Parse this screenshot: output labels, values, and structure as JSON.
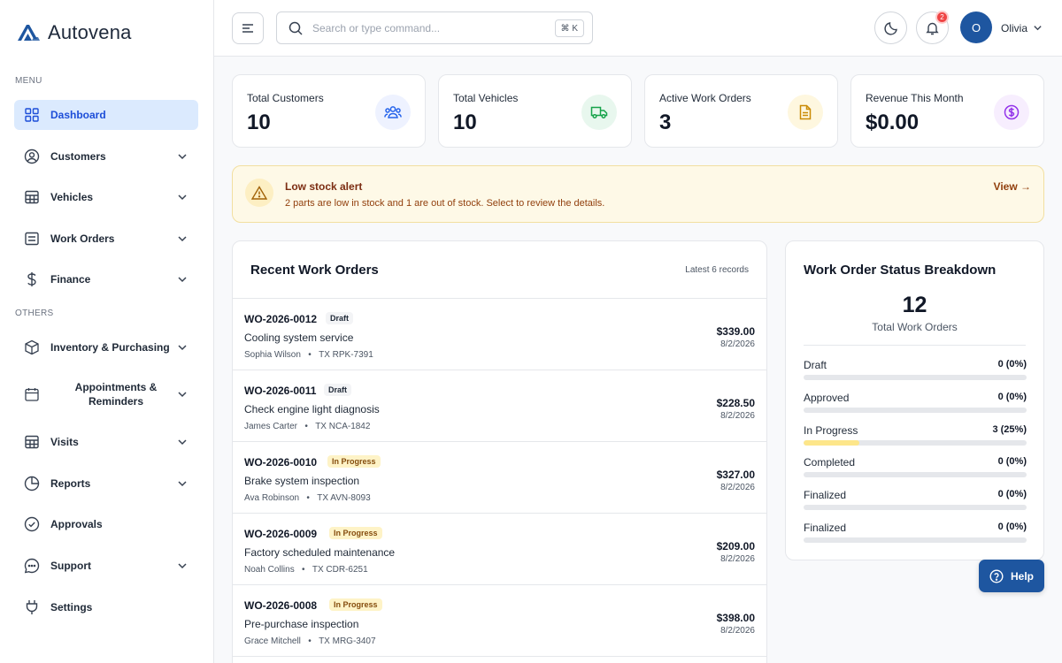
{
  "app": {
    "name": "Autovena"
  },
  "sidebar": {
    "menu_label": "MENU",
    "others_label": "OTHERS",
    "items": [
      {
        "label": "Dashboard",
        "icon": "grid-icon"
      },
      {
        "label": "Customers",
        "icon": "user-circle-icon"
      },
      {
        "label": "Vehicles",
        "icon": "table-icon"
      },
      {
        "label": "Work Orders",
        "icon": "list-icon"
      },
      {
        "label": "Finance",
        "icon": "dollar-icon"
      },
      {
        "label": "Inventory & Purchasing",
        "icon": "box-icon"
      },
      {
        "label": "Appointments & Reminders",
        "icon": "calendar-icon"
      },
      {
        "label": "Visits",
        "icon": "table-icon"
      },
      {
        "label": "Reports",
        "icon": "pie-chart-icon"
      },
      {
        "label": "Approvals",
        "icon": "check-circle-icon"
      },
      {
        "label": "Support",
        "icon": "chat-icon"
      },
      {
        "label": "Settings",
        "icon": "plug-icon"
      }
    ]
  },
  "topbar": {
    "search_placeholder": "Search or type command...",
    "shortcut": "⌘ K",
    "notification_count": "2",
    "user_initial": "O",
    "user_name": "Olivia"
  },
  "stats": [
    {
      "title": "Total Customers",
      "value": "10",
      "icon": "users-icon",
      "color": "#2563eb",
      "bg": "#eef2ff"
    },
    {
      "title": "Total Vehicles",
      "value": "10",
      "icon": "truck-icon",
      "color": "#16a34a",
      "bg": "#e8f7ee"
    },
    {
      "title": "Active Work Orders",
      "value": "3",
      "icon": "document-icon",
      "color": "#ca8a04",
      "bg": "#fef7df"
    },
    {
      "title": "Revenue This Month",
      "value": "$0.00",
      "icon": "dollar-circle-icon",
      "color": "#9333ea",
      "bg": "#f7eefe"
    }
  ],
  "alert": {
    "title": "Low stock alert",
    "message": "2 parts are low in stock and 1 are out of stock. Select to review the details.",
    "action": "View →"
  },
  "recent_orders": {
    "title": "Recent Work Orders",
    "subtitle": "Latest 6 records",
    "rows": [
      {
        "id": "WO-2026-0012",
        "status": "Draft",
        "desc": "Cooling system service",
        "customer": "Sophia Wilson",
        "plate": "TX RPK-7391",
        "amount": "$339.00",
        "date": "8/2/2026"
      },
      {
        "id": "WO-2026-0011",
        "status": "Draft",
        "desc": "Check engine light diagnosis",
        "customer": "James Carter",
        "plate": "TX NCA-1842",
        "amount": "$228.50",
        "date": "8/2/2026"
      },
      {
        "id": "WO-2026-0010",
        "status": "In Progress",
        "desc": "Brake system inspection",
        "customer": "Ava Robinson",
        "plate": "TX AVN-8093",
        "amount": "$327.00",
        "date": "8/2/2026"
      },
      {
        "id": "WO-2026-0009",
        "status": "In Progress",
        "desc": "Factory scheduled maintenance",
        "customer": "Noah Collins",
        "plate": "TX CDR-6251",
        "amount": "$209.00",
        "date": "8/2/2026"
      },
      {
        "id": "WO-2026-0008",
        "status": "In Progress",
        "desc": "Pre-purchase inspection",
        "customer": "Grace Mitchell",
        "plate": "TX MRG-3407",
        "amount": "$398.00",
        "date": "8/2/2026"
      }
    ]
  },
  "breakdown": {
    "title": "Work Order Status Breakdown",
    "total": "12",
    "total_label": "Total Work Orders",
    "rows": [
      {
        "label": "Draft",
        "value": "0 (0%)",
        "fraction": 0
      },
      {
        "label": "Approved",
        "value": "0 (0%)",
        "fraction": 0
      },
      {
        "label": "In Progress",
        "value": "3 (25%)",
        "fraction": 0.25
      },
      {
        "label": "Completed",
        "value": "0 (0%)",
        "fraction": 0
      },
      {
        "label": "Finalized",
        "value": "0 (0%)",
        "fraction": 0
      },
      {
        "label": "Finalized",
        "value": "0 (0%)",
        "fraction": 0
      }
    ]
  },
  "help": {
    "label": "Help"
  }
}
